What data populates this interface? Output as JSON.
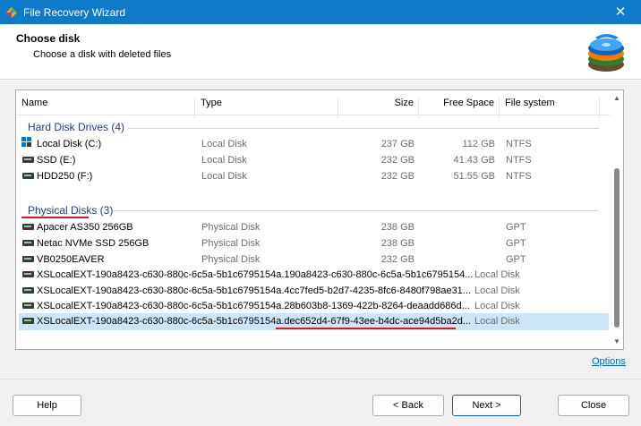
{
  "window": {
    "title": "File Recovery Wizard",
    "close_glyph": "✕"
  },
  "header": {
    "heading": "Choose disk",
    "subheading": "Choose a disk with deleted files"
  },
  "columns": {
    "name": "Name",
    "type": "Type",
    "size": "Size",
    "free_space": "Free Space",
    "file_system": "File system"
  },
  "groups": {
    "hdd": {
      "label": "Hard Disk Drives (4)"
    },
    "physical": {
      "label": "Physical Disks (3)"
    }
  },
  "drives": [
    {
      "name": "Local Disk (C:)",
      "type": "Local Disk",
      "size": "237 GB",
      "free": "112 GB",
      "fs": "NTFS",
      "icon": "windows-drive-icon"
    },
    {
      "name": "SSD (E:)",
      "type": "Local Disk",
      "size": "232 GB",
      "free": "41.43 GB",
      "fs": "NTFS",
      "icon": "drive-icon"
    },
    {
      "name": "HDD250 (F:)",
      "type": "Local Disk",
      "size": "232 GB",
      "free": "51.55 GB",
      "fs": "NTFS",
      "icon": "drive-icon"
    }
  ],
  "physical": [
    {
      "name": "Apacer AS350 256GB",
      "type": "Physical Disk",
      "size": "238 GB",
      "fs": "GPT"
    },
    {
      "name": "Netac NVMe SSD 256GB",
      "type": "Physical Disk",
      "size": "238 GB",
      "fs": "GPT"
    },
    {
      "name": "VB0250EAVER",
      "type": "Physical Disk",
      "size": "232 GB",
      "fs": "GPT"
    }
  ],
  "volumes": [
    {
      "name": "XSLocalEXT-190a8423-c630-880c-6c5a-5b1c6795154a.190a8423-c630-880c-6c5a-5b1c6795154...",
      "type": "Local Disk"
    },
    {
      "name": "XSLocalEXT-190a8423-c630-880c-6c5a-5b1c6795154a.4cc7fed5-b2d7-4235-8fc6-8480f798ae31...",
      "type": "Local Disk"
    },
    {
      "name": "XSLocalEXT-190a8423-c630-880c-6c5a-5b1c6795154a.28b603b8-1369-422b-8264-deaadd686d...",
      "type": "Local Disk"
    },
    {
      "name": "XSLocalEXT-190a8423-c630-880c-6c5a-5b1c6795154a.dec652d4-67f9-43ee-b4dc-ace94d5ba2d...",
      "type": "Local Disk",
      "selected": true
    }
  ],
  "links": {
    "options": "Options"
  },
  "buttons": {
    "help": "Help",
    "back": "< Back",
    "next": "Next >",
    "close": "Close"
  },
  "colors": {
    "titlebar": "#0f7ac8",
    "selection": "#cde6f7",
    "group_text": "#1e3b8b",
    "annotation": "#e0141c",
    "link": "#0066cc"
  }
}
